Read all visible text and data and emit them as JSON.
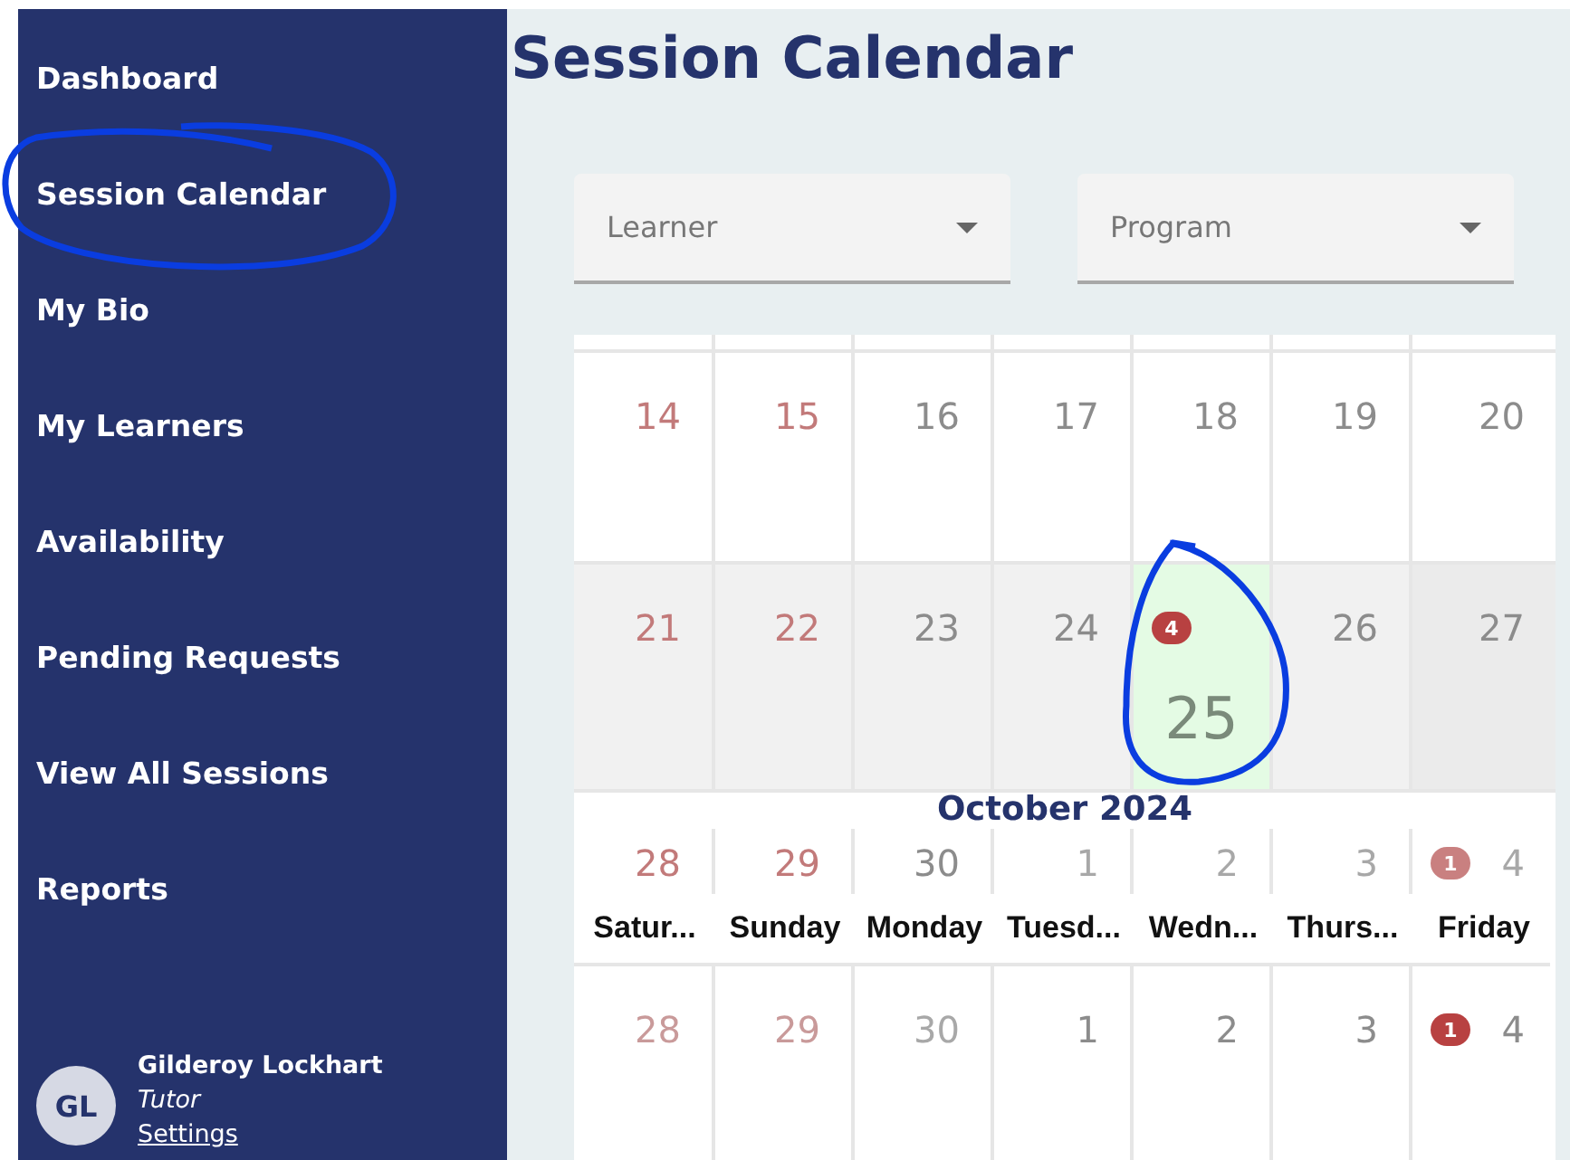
{
  "sidebar": {
    "items": [
      {
        "label": "Dashboard"
      },
      {
        "label": "Session Calendar"
      },
      {
        "label": "My Bio"
      },
      {
        "label": "My Learners"
      },
      {
        "label": "Availability"
      },
      {
        "label": "Pending Requests"
      },
      {
        "label": "View All Sessions"
      },
      {
        "label": "Reports"
      }
    ],
    "user": {
      "initials": "GL",
      "name": "Gilderoy Lockhart",
      "role": "Tutor",
      "settings_link": "Settings"
    }
  },
  "page_title": "Session Calendar",
  "filters": [
    {
      "placeholder": "Learner"
    },
    {
      "placeholder": "Program"
    }
  ],
  "calendar": {
    "month_title": "October 2024",
    "weeks_above": [
      {
        "highlighted": false,
        "days": [
          {
            "label": "14",
            "kind": "weekend"
          },
          {
            "label": "15",
            "kind": "weekend"
          },
          {
            "label": "16",
            "kind": "weekday"
          },
          {
            "label": "17",
            "kind": "weekday"
          },
          {
            "label": "18",
            "kind": "weekday"
          },
          {
            "label": "19",
            "kind": "weekday"
          },
          {
            "label": "20",
            "kind": "weekday"
          }
        ]
      },
      {
        "highlighted": true,
        "days": [
          {
            "label": "21",
            "kind": "weekend"
          },
          {
            "label": "22",
            "kind": "weekend"
          },
          {
            "label": "23",
            "kind": "weekday"
          },
          {
            "label": "24",
            "kind": "weekday"
          },
          {
            "label": "25",
            "kind": "today",
            "badge": "4"
          },
          {
            "label": "26",
            "kind": "weekday"
          },
          {
            "label": "27",
            "kind": "picked"
          }
        ]
      },
      {
        "highlighted": false,
        "days": [
          {
            "label": "28",
            "kind": "weekend"
          },
          {
            "label": "29",
            "kind": "weekend"
          },
          {
            "label": "30",
            "kind": "weekday"
          },
          {
            "label": "1",
            "kind": "weekday-faded"
          },
          {
            "label": "2",
            "kind": "weekday-faded"
          },
          {
            "label": "3",
            "kind": "weekday-faded"
          },
          {
            "label": "4",
            "kind": "weekday-faded",
            "badge": "1"
          }
        ]
      }
    ],
    "weekday_header": [
      "Satur...",
      "Sunday",
      "Monday",
      "Tuesd...",
      "Wedn...",
      "Thurs...",
      "Friday"
    ],
    "weeks_below": [
      {
        "highlighted": false,
        "days": [
          {
            "label": "28",
            "kind": "weekend-faded"
          },
          {
            "label": "29",
            "kind": "weekend-faded"
          },
          {
            "label": "30",
            "kind": "weekday-faded"
          },
          {
            "label": "1",
            "kind": "weekday"
          },
          {
            "label": "2",
            "kind": "weekday"
          },
          {
            "label": "3",
            "kind": "weekday"
          },
          {
            "label": "4",
            "kind": "weekday",
            "badge": "1"
          }
        ]
      }
    ]
  }
}
